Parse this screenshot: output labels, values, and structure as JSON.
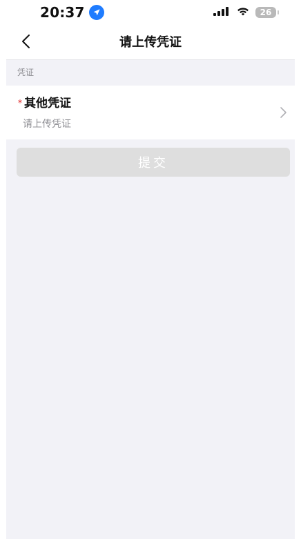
{
  "status_bar": {
    "time": "20:37",
    "battery": "26",
    "icons": [
      "location-icon",
      "cellular-icon",
      "wifi-icon",
      "battery-icon"
    ]
  },
  "nav": {
    "title": "请上传凭证",
    "back_icon": "chevron-left-icon"
  },
  "section": {
    "header": "凭证"
  },
  "form": {
    "row": {
      "required": "*",
      "label": "其他凭证",
      "placeholder": "请上传凭证",
      "icon": "chevron-right-icon"
    }
  },
  "actions": {
    "submit_label": "提交",
    "submit_enabled": false
  },
  "colors": {
    "accent_location": "#1f7cff",
    "required_red": "#e02020",
    "page_bg": "#f2f2f7",
    "button_disabled_bg": "#dedede",
    "text_secondary": "#8e8e93"
  }
}
